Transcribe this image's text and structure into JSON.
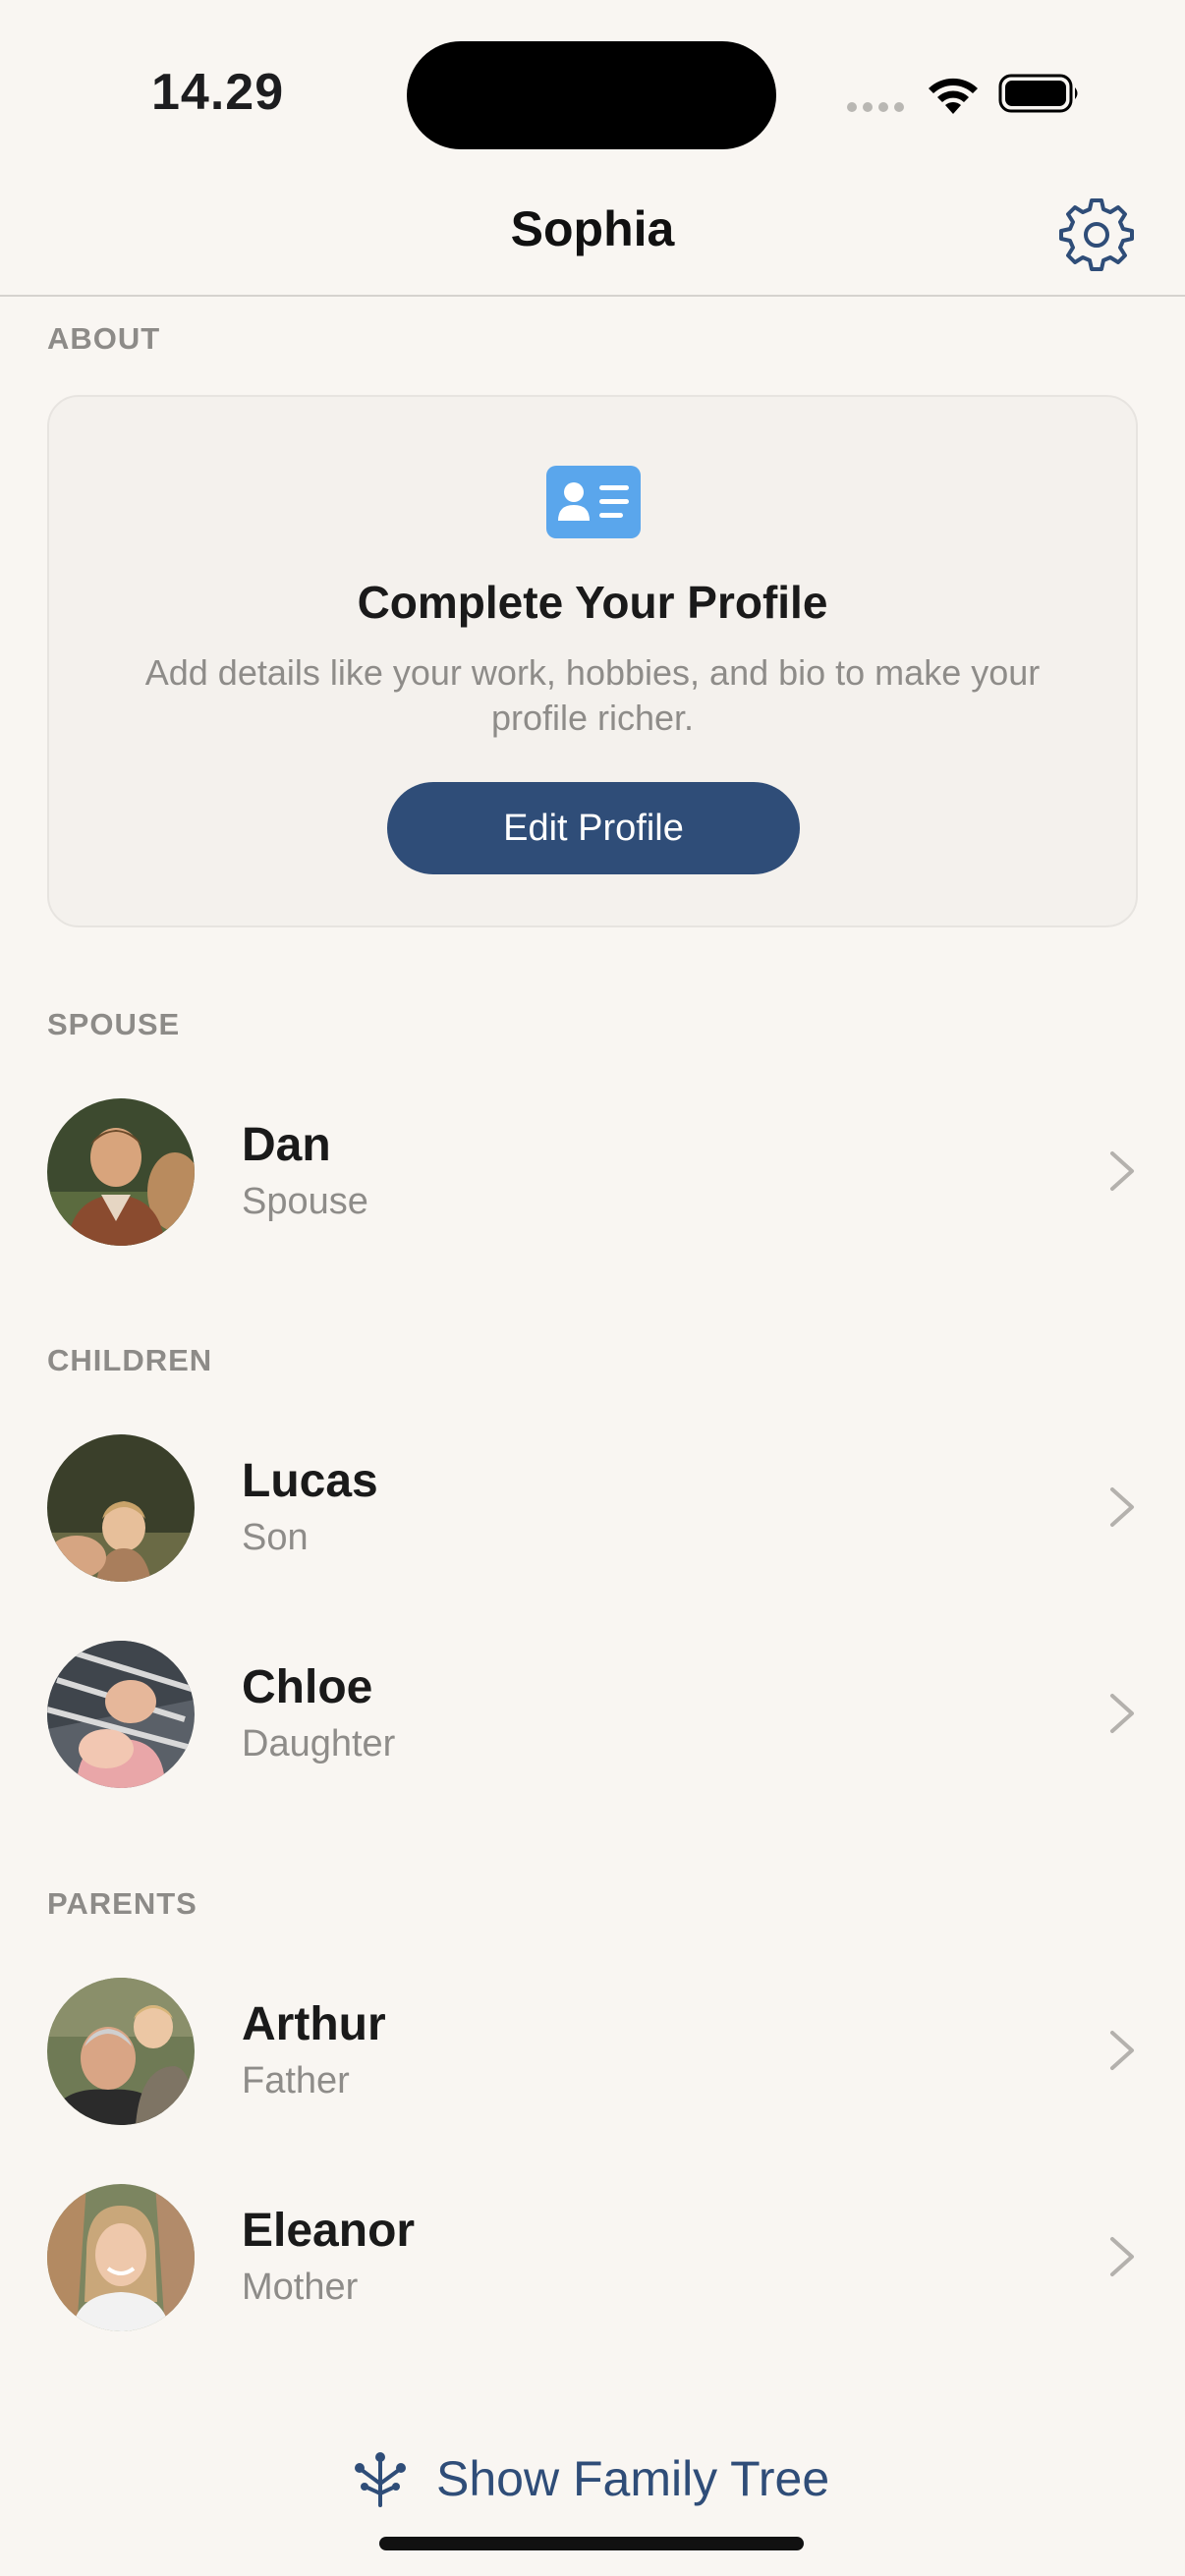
{
  "status_bar": {
    "time": "14.29"
  },
  "nav": {
    "title": "Sophia",
    "settings_icon": "gear-icon"
  },
  "about": {
    "header": "ABOUT",
    "card_icon": "contact-card-icon",
    "card_title": "Complete Your Profile",
    "card_subtitle": "Add details like your work, hobbies, and bio to make your profile richer.",
    "button_label": "Edit Profile"
  },
  "spouse": {
    "header": "SPOUSE",
    "people": [
      {
        "name": "Dan",
        "relation": "Spouse"
      }
    ]
  },
  "children": {
    "header": "CHILDREN",
    "people": [
      {
        "name": "Lucas",
        "relation": "Son"
      },
      {
        "name": "Chloe",
        "relation": "Daughter"
      }
    ]
  },
  "parents": {
    "header": "PARENTS",
    "people": [
      {
        "name": "Arthur",
        "relation": "Father"
      },
      {
        "name": "Eleanor",
        "relation": "Mother"
      }
    ]
  },
  "footer": {
    "tree_button_label": "Show Family Tree",
    "tree_icon": "family-tree-icon"
  },
  "colors": {
    "background": "#f9f6f2",
    "accent": "#2f4d78",
    "card_icon_blue": "#5aa6ec",
    "secondary_text": "#8e8c89"
  }
}
